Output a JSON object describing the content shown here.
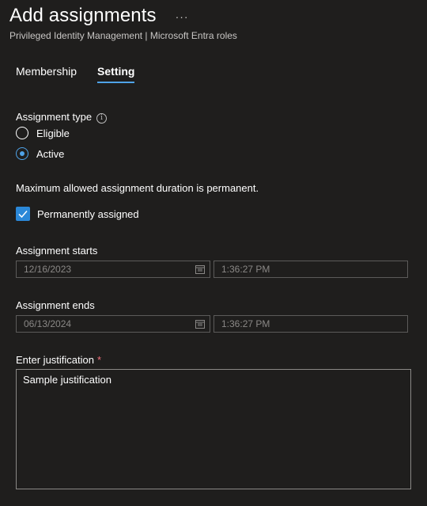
{
  "header": {
    "title": "Add assignments",
    "more_label": "···",
    "subtitle": "Privileged Identity Management | Microsoft Entra roles"
  },
  "tabs": [
    {
      "label": "Membership",
      "selected": false
    },
    {
      "label": "Setting",
      "selected": true
    }
  ],
  "assignment_type": {
    "label": "Assignment type",
    "info_icon": "i",
    "options": [
      {
        "label": "Eligible",
        "checked": false
      },
      {
        "label": "Active",
        "checked": true
      }
    ]
  },
  "duration_note": "Maximum allowed assignment duration is permanent.",
  "permanent": {
    "label": "Permanently assigned",
    "checked": true
  },
  "starts": {
    "label": "Assignment starts",
    "date": "12/16/2023",
    "time": "1:36:27 PM"
  },
  "ends": {
    "label": "Assignment ends",
    "date": "06/13/2024",
    "time": "1:36:27 PM"
  },
  "justification": {
    "label": "Enter justification",
    "required_mark": "*",
    "value": "Sample justification"
  },
  "colors": {
    "accent": "#4fa3e8",
    "checkbox": "#2b88d8",
    "required": "#f1707b",
    "background": "#1f1e1d"
  }
}
